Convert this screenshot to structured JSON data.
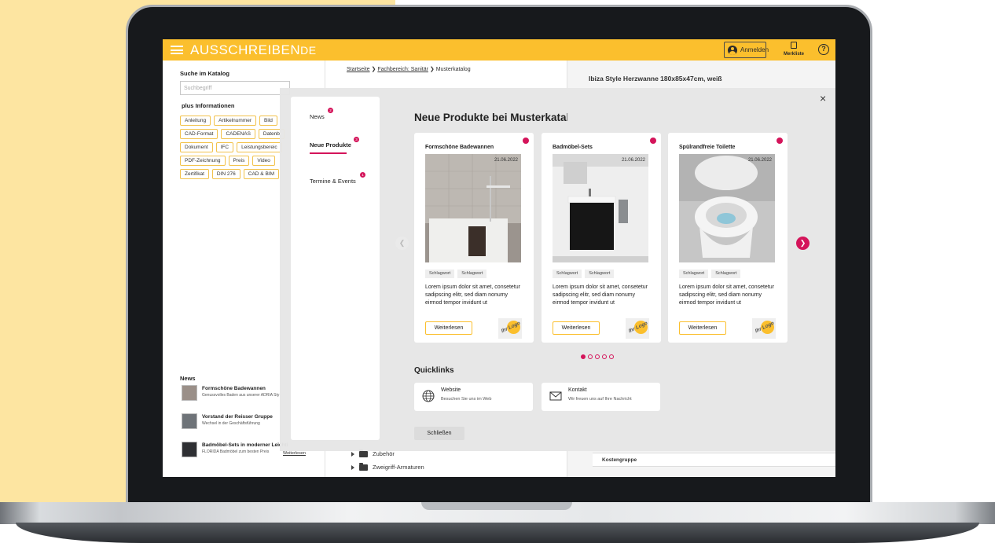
{
  "app": {
    "logo_main": "AUSSCHREIBEN",
    "logo_tld": "DE",
    "login_label": "Anmelden",
    "merkliste_label": "Merkliste",
    "help_label": "?"
  },
  "left_column": {
    "search_heading": "Suche im Katalog",
    "search_placeholder": "Suchbegriff",
    "info_heading": "plus Informationen",
    "chips": [
      "Anleitung",
      "Artikelnummer",
      "Bild",
      "CAD-Format",
      "CADENAS",
      "Datenb",
      "Dokument",
      "IFC",
      "Leistungsbereic",
      "PDF-Zeichnung",
      "Preis",
      "Video",
      "Zertifikat",
      "DIN 276",
      "CAD & BIM"
    ],
    "news_heading": "News",
    "news": [
      {
        "title": "Formschöne Badewannen",
        "sub": "Genussvolles Baden aus unserer ADRIA Sty"
      },
      {
        "title": "Vorstand der Reisser Gruppe",
        "sub": "Wechsel in der Geschäftsführung"
      },
      {
        "title": "Badmöbel-Sets in moderner Leichti",
        "sub": "FLORIDA Badmöbel zum besten Preis"
      }
    ],
    "weiterlesen": "Weiterlesen"
  },
  "middle_column": {
    "breadcrumb": [
      "Startseite",
      "Fachbereich: Sanitär",
      "Musterkatalog"
    ],
    "tree": [
      "Zubehör",
      "Zweigriff-Armaturen"
    ]
  },
  "right_column": {
    "product_title": "Ibiza Style Herzwanne 180x85x47cm, weiß",
    "kostengruppe": "Kostengruppe"
  },
  "modal": {
    "close_symbol": "×",
    "nav": [
      {
        "label": "News",
        "badge": "2",
        "active": false
      },
      {
        "label": "Neue Produkte",
        "badge": "3",
        "active": true
      },
      {
        "label": "Termine & Events",
        "badge": "1",
        "active": false
      }
    ],
    "section_title": "Neue Produkte bei Musterkatalog",
    "cards": [
      {
        "title": "Formschöne Badewannen",
        "date": "21.06.2022",
        "tags": [
          "Schlagwort",
          "Schlagwort"
        ],
        "text": "Lorem ipsum dolor sit amet, consetetur sadipscing elitr, sed diam nonumy eirmod tempor invidunt ut",
        "button": "Weiterlesen",
        "logo": "Ihr Logo"
      },
      {
        "title": "Badmöbel-Sets",
        "date": "21.06.2022",
        "tags": [
          "Schlagwort",
          "Schlagwort"
        ],
        "text": "Lorem ipsum dolor sit amet, consetetur sadipscing elitr, sed diam nonumy eirmod tempor invidunt ut",
        "button": "Weiterlesen",
        "logo": "Ihr Logo"
      },
      {
        "title": "Spülrandfreie Toilette",
        "date": "21.06.2022",
        "tags": [
          "Schlagwort",
          "Schlagwort"
        ],
        "text": "Lorem ipsum dolor sit amet, consetetur sadipscing elitr, sed diam nonumy eirmod tempor invidunt ut",
        "button": "Weiterlesen",
        "logo": "Ihr Logo"
      }
    ],
    "pager": {
      "count": 5,
      "active": 1
    },
    "quicklinks_title": "Quicklinks",
    "quicklinks": [
      {
        "label": "Website",
        "sub": "Besuchen Sie uns im Web",
        "icon": "globe-icon"
      },
      {
        "label": "Kontakt",
        "sub": "Wir freuen uns auf Ihre Nachricht",
        "icon": "mail-icon"
      }
    ],
    "close_button": "Schließen"
  },
  "colors": {
    "brand": "#fbbf2d",
    "accent": "#d4145a",
    "backdrop": "#fde5a1"
  }
}
